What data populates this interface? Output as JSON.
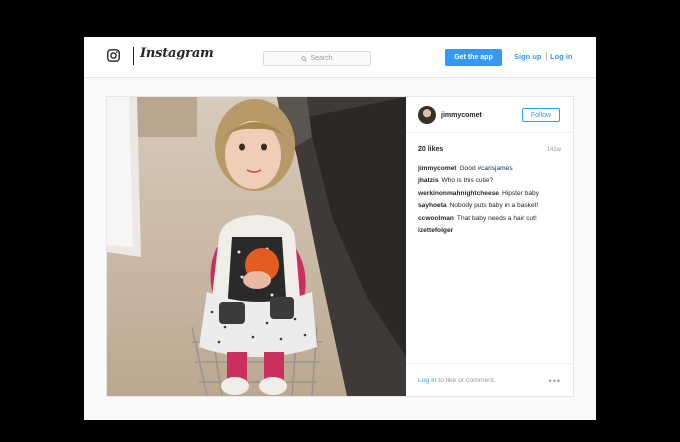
{
  "header": {
    "wordmark": "Instagram",
    "search_placeholder": "Search",
    "get_app": "Get the app",
    "sign_up": "Sign up",
    "log_in": "Log in"
  },
  "post": {
    "username": "jimmycomet",
    "follow": "Follow",
    "likes": "20 likes",
    "time": "141w",
    "comments": [
      {
        "user": "jimmycomet",
        "text": "Good ",
        "tag": "#carisjames"
      },
      {
        "user": "jhatzis",
        "text": "Who is this cutie?",
        "tag": ""
      },
      {
        "user": "werkinonmahnightcheese",
        "text": "Hipster baby",
        "tag": ""
      },
      {
        "user": "sayhoeta",
        "text": "Nobody puts baby in a basket!",
        "tag": ""
      },
      {
        "user": "ccwoolman",
        "text": "That baby needs a hair cut!",
        "tag": ""
      },
      {
        "user": "izettefolger",
        "text": "",
        "tag": ""
      }
    ],
    "footer_login": "Log in",
    "footer_rest": " to like or comment.",
    "more": "•••"
  },
  "colors": {
    "accent": "#3897f0",
    "background": "#fafafa",
    "outer": "#000000"
  },
  "icons": [
    "instagram-logo-icon",
    "search-icon",
    "more-options-icon"
  ]
}
